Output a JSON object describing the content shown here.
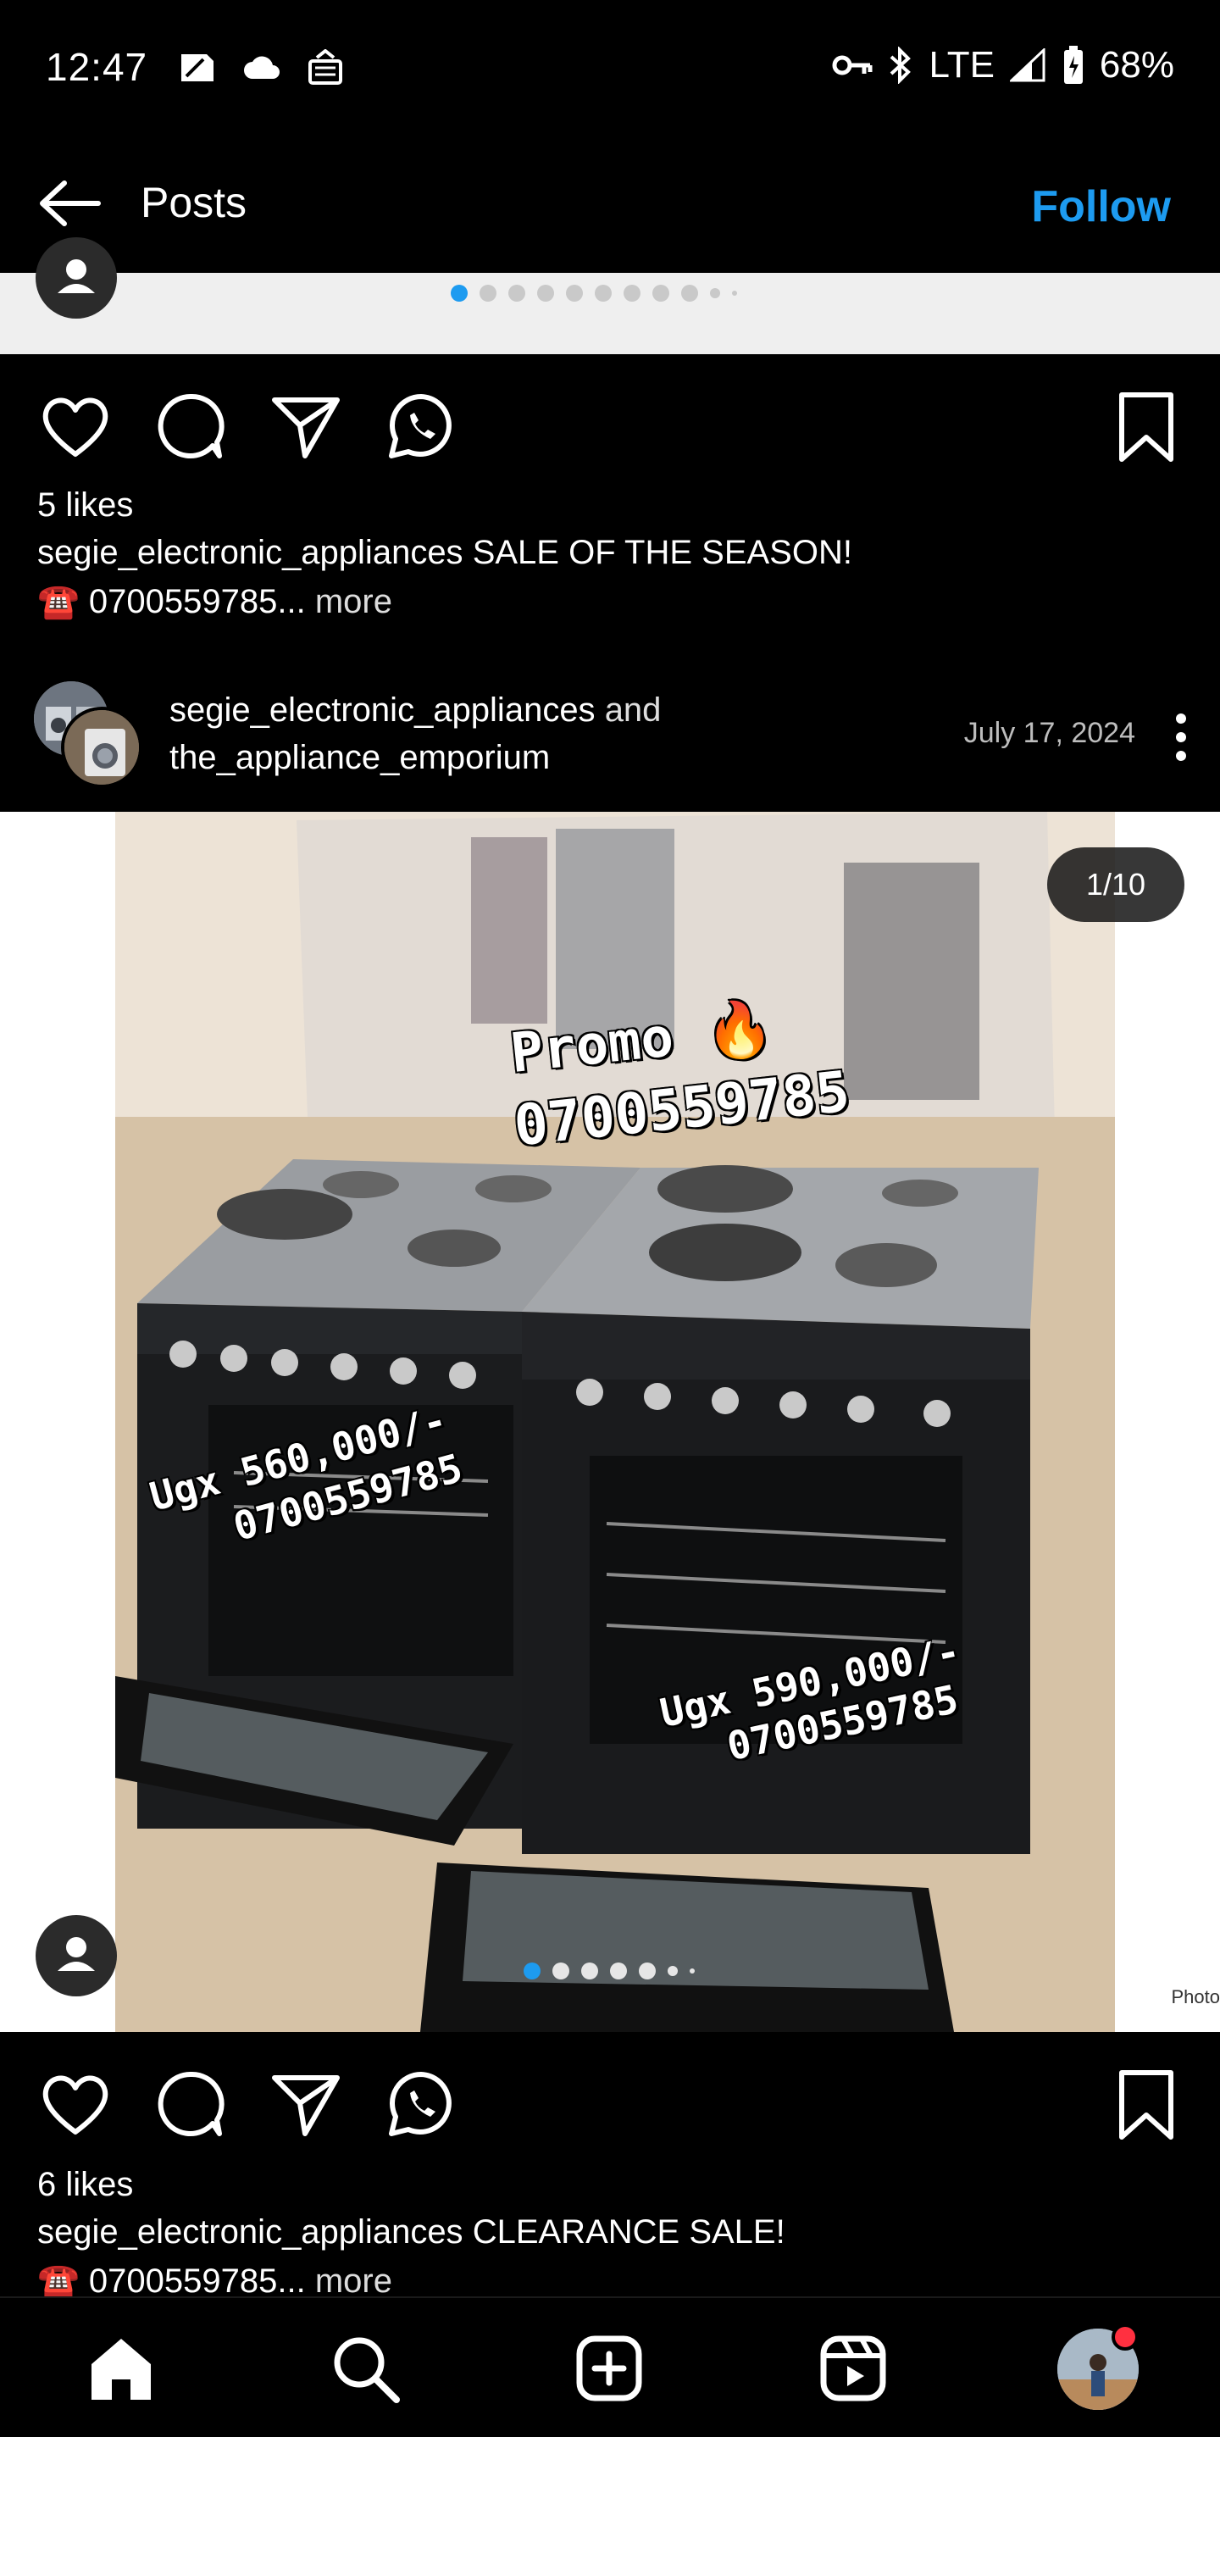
{
  "status_bar": {
    "time": "12:47",
    "network": "LTE",
    "battery": "68%",
    "left_icons": [
      "sim-card-icon",
      "cloud-icon",
      "cast-icon"
    ],
    "right_icons": [
      "vpn-key-icon",
      "bluetooth-icon",
      "signal-icon",
      "battery-icon"
    ]
  },
  "header": {
    "title": "Posts",
    "follow_label": "Follow"
  },
  "colors": {
    "accent": "#1d9bf0",
    "background": "#000000",
    "notification": "#ff3040"
  },
  "previous_post": {
    "carousel_dots": 11,
    "active_dot": 0
  },
  "post1": {
    "likes": "5 likes",
    "username": "segie_electronic_appliances",
    "caption": "SALE OF THE SEASON!",
    "caption_line2": "☎️ 0700559785...",
    "more_label": "more"
  },
  "post2": {
    "author1": "segie_electronic_appliances",
    "and_label": "and",
    "author2": "the_appliance_emporium",
    "date": "July 17, 2024",
    "counter": "1/10",
    "overlay": {
      "promo": "Promo 🔥",
      "phone": "0700559785",
      "price_left": "Ugx 560,000/-",
      "phone_left": "0700559785",
      "price_right": "Ugx 590,000/-",
      "phone_right": "0700559785",
      "credit": "Photo"
    },
    "likes": "6 likes",
    "username": "segie_electronic_appliances",
    "caption": "CLEARANCE SALE!",
    "caption_line2": "☎️ 0700559785...",
    "more_label": "more"
  },
  "bottom_nav": [
    "home-icon",
    "search-icon",
    "create-icon",
    "reels-icon",
    "profile-avatar"
  ]
}
